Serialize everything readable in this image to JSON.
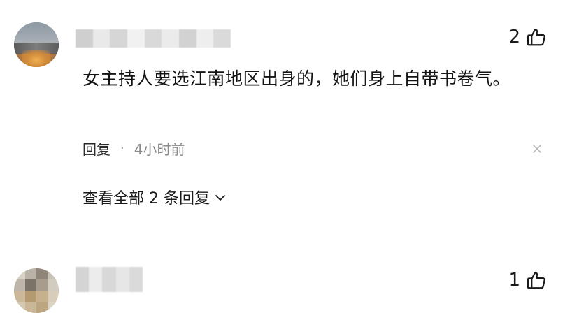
{
  "comments": [
    {
      "likes": "2",
      "text": "女主持人要选江南地区出身的，她们身上自带书卷气。",
      "reply_label": "回复",
      "separator": "·",
      "time": "4小时前",
      "view_replies": "查看全部 2 条回复"
    },
    {
      "likes": "1"
    }
  ],
  "icons": {
    "like": "thumbs-up-icon",
    "close": "close-icon",
    "expand": "chevron-down-icon"
  },
  "colors": {
    "text": "#1a1a1a",
    "muted": "#8a8a8a"
  }
}
